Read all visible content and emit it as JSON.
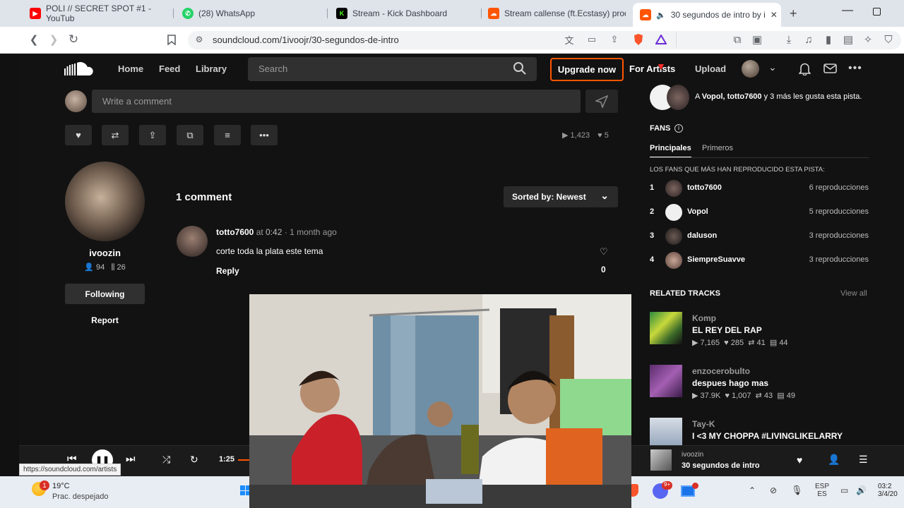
{
  "browser": {
    "tabs": [
      {
        "label": "POLI // SECRET SPOT #1 - YouTub",
        "icon": "youtube-icon",
        "color": "#ff0000"
      },
      {
        "label": "(28) WhatsApp",
        "icon": "whatsapp-icon",
        "color": "#25d366"
      },
      {
        "label": "Stream - Kick Dashboard",
        "icon": "kick-icon",
        "color": "#53fc18"
      },
      {
        "label": "Stream callense (ft.Ecstasy) prod.g",
        "icon": "soundcloud-icon",
        "color": "#ff5500"
      },
      {
        "label": "30 segundos de intro by i",
        "icon": "soundcloud-icon",
        "color": "#ff5500"
      }
    ],
    "url": "soundcloud.com/1ivoojr/30-segundos-de-intro",
    "status_url": "https://soundcloud.com/artists"
  },
  "nav": {
    "home": "Home",
    "feed": "Feed",
    "library": "Library",
    "search_placeholder": "Search",
    "upgrade": "Upgrade now",
    "for_artists": "For Artists",
    "upload": "Upload"
  },
  "comment_box": {
    "placeholder": "Write a comment"
  },
  "stats": {
    "plays": "1,423",
    "likes": "5"
  },
  "artist": {
    "name": "ivoozin",
    "followers": "94",
    "tracks": "26",
    "follow_button": "Following",
    "report": "Report"
  },
  "comments": {
    "count_label": "1 comment",
    "sort_label": "Sorted by: Newest",
    "items": [
      {
        "user": "totto7600",
        "at": "at",
        "time": "0:42",
        "age": "1 month ago",
        "text": "corte toda la plata este tema",
        "reply": "Reply",
        "likes": "0"
      }
    ]
  },
  "sidebar": {
    "likes_text_pre": "A ",
    "likes_names": "Vopol, totto7600",
    "likes_text_post": " y 3 más les gusta esta pista.",
    "fans_title": "FANS",
    "fans_tabs": [
      "Principales",
      "Primeros"
    ],
    "fans_subtitle": "LOS FANS QUE MÁS HAN REPRODUCIDO ESTA PISTA:",
    "fans": [
      {
        "rank": "1",
        "name": "totto7600",
        "plays": "6 reproducciones"
      },
      {
        "rank": "2",
        "name": "Vopol",
        "plays": "5 reproducciones"
      },
      {
        "rank": "3",
        "name": "daluson",
        "plays": "3 reproducciones"
      },
      {
        "rank": "4",
        "name": "SiempreSuavve",
        "plays": "3 reproducciones"
      }
    ],
    "related_title": "RELATED TRACKS",
    "view_all": "View all",
    "related": [
      {
        "artist": "Komp",
        "title": "EL REY DEL RAP",
        "plays": "7,165",
        "likes": "285",
        "reposts": "41",
        "comments": "44"
      },
      {
        "artist": "enzocerobulto",
        "title": "despues hago mas",
        "plays": "37.9K",
        "likes": "1,007",
        "reposts": "43",
        "comments": "49"
      },
      {
        "artist": "Tay-K",
        "title": "I <3 MY CHOPPA #LIVINGLIKELARRY"
      }
    ]
  },
  "player": {
    "time": "1:25",
    "now_artist": "ivoozin",
    "now_title": "30 segundos de intro"
  },
  "taskbar": {
    "weather_temp": "19°C",
    "weather_desc": "Prac. despejado",
    "weather_badge": "1",
    "lang_top": "ESP",
    "lang_bottom": "ES",
    "clock_time": "03:2",
    "clock_date": "3/4/20"
  }
}
